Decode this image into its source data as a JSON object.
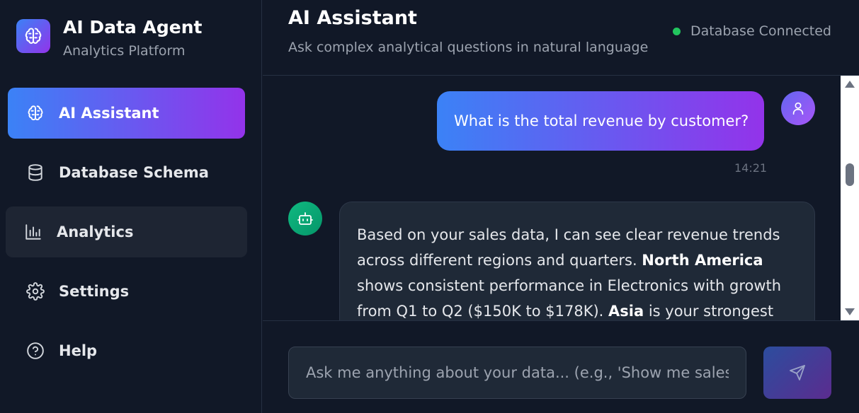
{
  "brand": {
    "title": "AI Data Agent",
    "subtitle": "Analytics Platform",
    "logo_icon": "brain-icon"
  },
  "sidebar": {
    "items": [
      {
        "label": "AI Assistant",
        "icon": "brain-icon",
        "state": "active"
      },
      {
        "label": "Database Schema",
        "icon": "database-icon",
        "state": "default"
      },
      {
        "label": "Analytics",
        "icon": "bar-chart-icon",
        "state": "hover"
      },
      {
        "label": "Settings",
        "icon": "gear-icon",
        "state": "default"
      },
      {
        "label": "Help",
        "icon": "help-circle-icon",
        "state": "default"
      }
    ]
  },
  "header": {
    "title": "AI Assistant",
    "subtitle": "Ask complex analytical questions in natural language",
    "status": "Database Connected",
    "status_color": "#22c55e"
  },
  "chat": {
    "user_message": "What is the total revenue by customer?",
    "user_time": "14:21",
    "bot_message": {
      "part1": "Based on your sales data, I can see clear revenue trends across different regions and quarters. ",
      "bold1": "North America",
      "part2": " shows consistent performance in Electronics with growth from Q1 to Q2 ($150K to $178K). ",
      "bold2": "Asia",
      "part3": " is your strongest"
    }
  },
  "composer": {
    "placeholder": "Ask me anything about your data... (e.g., 'Show me sales",
    "send_icon": "send-icon"
  },
  "colors": {
    "accent_start": "#3b82f6",
    "accent_end": "#9333ea",
    "background": "#111827"
  }
}
